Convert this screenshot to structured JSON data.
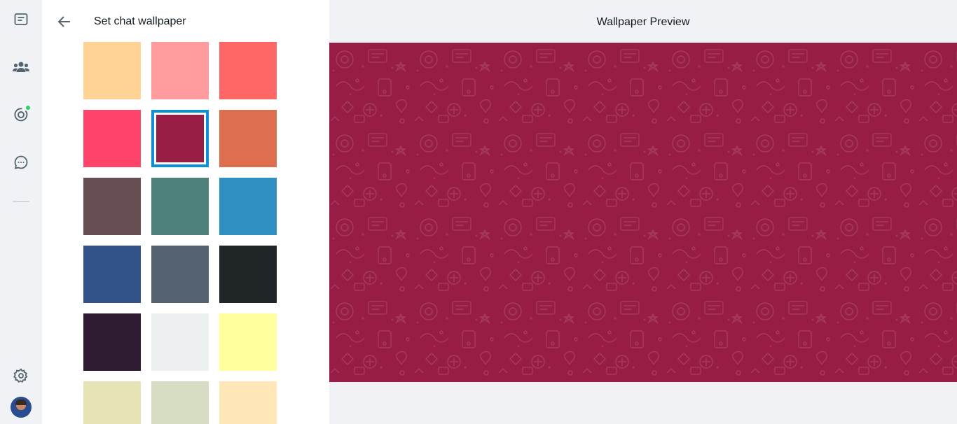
{
  "sidebar": {
    "icons": [
      "chats-icon",
      "communities-icon",
      "status-icon",
      "channels-icon",
      "settings-icon"
    ]
  },
  "panel": {
    "title": "Set chat wallpaper",
    "swatches": [
      {
        "color": "#d5dcc2",
        "selected": false
      },
      {
        "color": "#e6e3b5",
        "selected": false
      },
      {
        "color": "#fff0a8",
        "selected": false
      },
      {
        "color": "#fed395",
        "selected": false
      },
      {
        "color": "#ff9b9c",
        "selected": false
      },
      {
        "color": "#ff6767",
        "selected": false
      },
      {
        "color": "#ff4369",
        "selected": false
      },
      {
        "color": "#981d44",
        "selected": true
      },
      {
        "color": "#dd6f4f",
        "selected": false
      },
      {
        "color": "#654d52",
        "selected": false
      },
      {
        "color": "#4f817b",
        "selected": false
      },
      {
        "color": "#2e8fc0",
        "selected": false
      },
      {
        "color": "#33528a",
        "selected": false
      },
      {
        "color": "#546270",
        "selected": false
      },
      {
        "color": "#1f2426",
        "selected": false
      },
      {
        "color": "#2f1b31",
        "selected": false
      },
      {
        "color": "#ecf0f1",
        "selected": false
      },
      {
        "color": "#ffff9e",
        "selected": false
      },
      {
        "color": "#e6e3b5",
        "selected": false
      },
      {
        "color": "#d5dcc2",
        "selected": false
      },
      {
        "color": "#ffe7b8",
        "selected": false
      }
    ]
  },
  "preview": {
    "title": "Wallpaper Preview",
    "background": "#981d44"
  }
}
